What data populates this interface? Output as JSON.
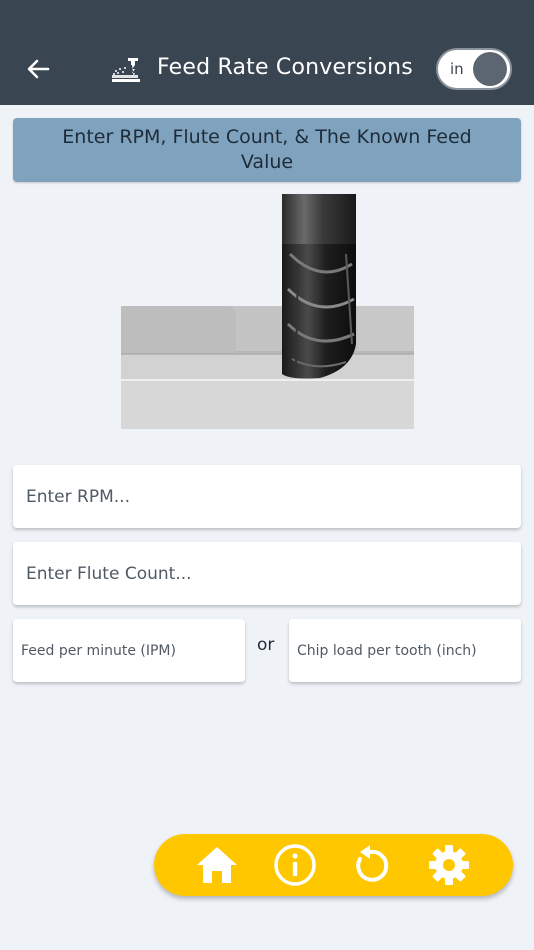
{
  "header": {
    "title": "Feed Rate Conversions",
    "back_icon": "arrow-left-icon",
    "logo_icon": "milling-machine-icon",
    "unit_toggle": {
      "label": "in",
      "state": "off"
    },
    "background": "#3a4552"
  },
  "banner": {
    "text": "Enter RPM, Flute Count, & The Known Feed Value",
    "background": "#7fa2bf"
  },
  "illustration": {
    "icon": "end-mill-cutting-icon"
  },
  "form": {
    "rpm": {
      "placeholder": "Enter RPM...",
      "value": ""
    },
    "flutes": {
      "placeholder": "Enter Flute Count...",
      "value": ""
    },
    "ipm": {
      "placeholder": "Feed per minute (IPM)",
      "value": ""
    },
    "or_label": "or",
    "chipload": {
      "placeholder": "Chip load per tooth (inch)",
      "value": ""
    }
  },
  "bottom_nav": {
    "background": "#ffc700",
    "items": [
      {
        "icon": "home-icon"
      },
      {
        "icon": "info-icon"
      },
      {
        "icon": "reset-icon"
      },
      {
        "icon": "settings-gear-icon"
      }
    ]
  }
}
